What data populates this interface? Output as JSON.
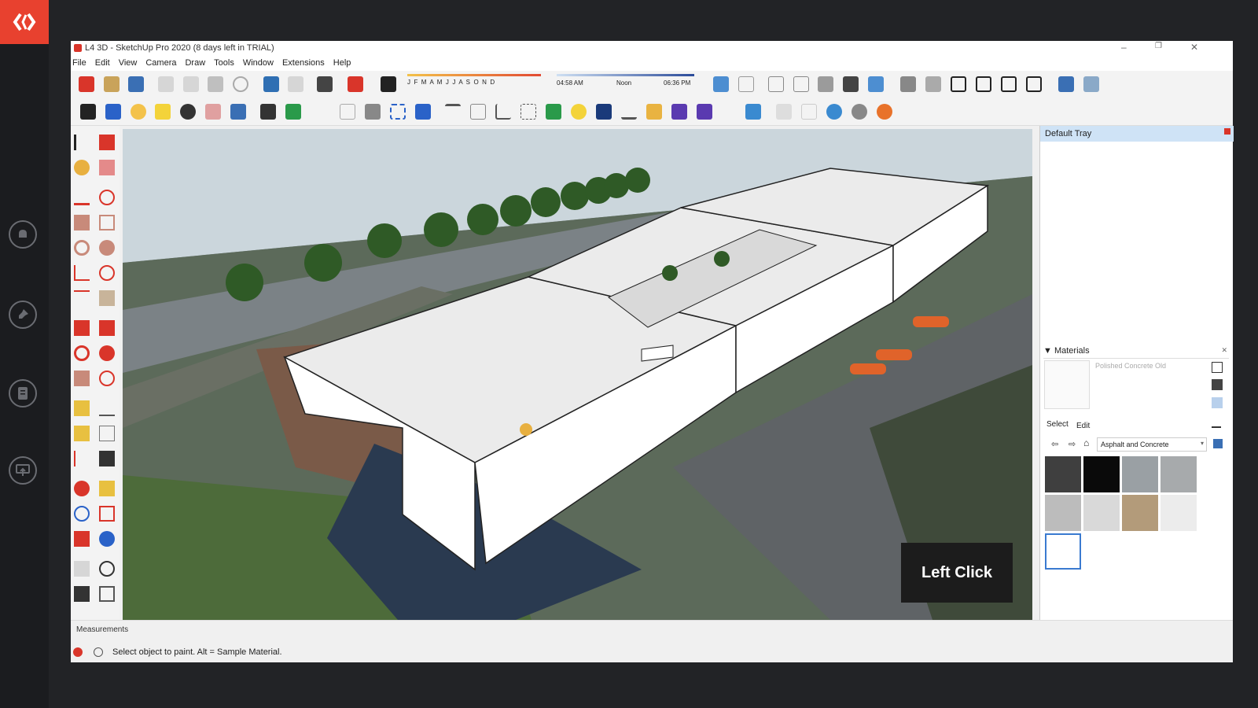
{
  "window": {
    "title": "L4 3D - SketchUp Pro 2020 (8 days left in TRIAL)"
  },
  "menu": [
    "File",
    "Edit",
    "View",
    "Camera",
    "Draw",
    "Tools",
    "Window",
    "Extensions",
    "Help"
  ],
  "shadow": {
    "months": "J  F  M  A  M  J  J  A  S  O  N  D",
    "time_start": "04:58 AM",
    "time_mid": "Noon",
    "time_end": "06:36 PM"
  },
  "tray": {
    "title": "Default Tray",
    "materials_title": "Materials",
    "current_material": "Polished Concrete Old",
    "tab_select": "Select",
    "tab_edit": "Edit",
    "library": "Asphalt and Concrete",
    "swatch_colors": [
      "#3f3f3f",
      "#0a0a0a",
      "#9aa0a4",
      "#a7aaac",
      "#bcbcbc",
      "#d9d9d9",
      "#b39b7a",
      "#ececec",
      "#ffffff"
    ]
  },
  "measurements_label": "Measurements",
  "status_text": "Select object to paint. Alt = Sample Material.",
  "overlay_caption": "Left Click",
  "colors": {
    "accent": "#e8412f",
    "tray_header": "#cfe3f6",
    "building": "#ffffff"
  }
}
